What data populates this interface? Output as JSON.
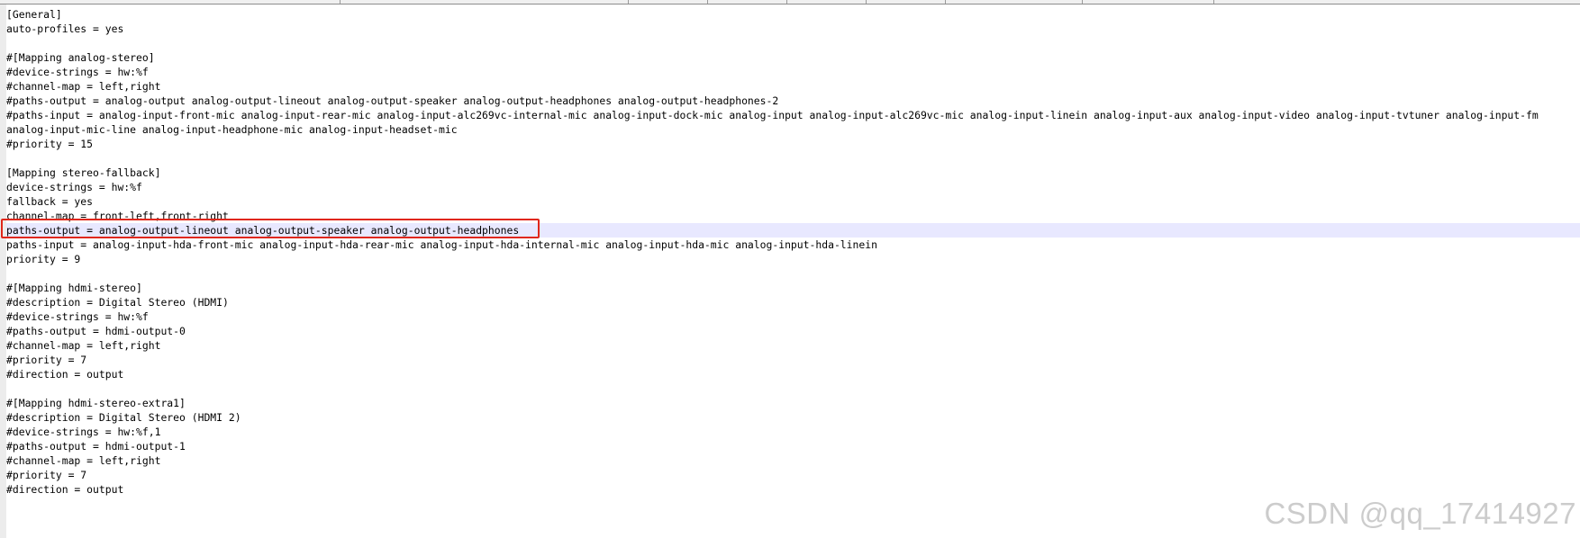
{
  "editor": {
    "lines": [
      "[General]",
      "auto-profiles = yes",
      "",
      "#[Mapping analog-stereo]",
      "#device-strings = hw:%f",
      "#channel-map = left,right",
      "#paths-output = analog-output analog-output-lineout analog-output-speaker analog-output-headphones analog-output-headphones-2",
      "#paths-input = analog-input-front-mic analog-input-rear-mic analog-input-alc269vc-internal-mic analog-input-dock-mic analog-input analog-input-alc269vc-mic analog-input-linein analog-input-aux analog-input-video analog-input-tvtuner analog-input-fm",
      "analog-input-mic-line analog-input-headphone-mic analog-input-headset-mic",
      "#priority = 15",
      "",
      "[Mapping stereo-fallback]",
      "device-strings = hw:%f",
      "fallback = yes",
      "channel-map = front-left,front-right",
      "paths-output = analog-output-lineout analog-output-speaker analog-output-headphones",
      "paths-input = analog-input-hda-front-mic analog-input-hda-rear-mic analog-input-hda-internal-mic analog-input-hda-mic analog-input-hda-linein",
      "priority = 9",
      "",
      "#[Mapping hdmi-stereo]",
      "#description = Digital Stereo (HDMI)",
      "#device-strings = hw:%f",
      "#paths-output = hdmi-output-0",
      "#channel-map = left,right",
      "#priority = 7",
      "#direction = output",
      "",
      "#[Mapping hdmi-stereo-extra1]",
      "#description = Digital Stereo (HDMI 2)",
      "#device-strings = hw:%f,1",
      "#paths-output = hdmi-output-1",
      "#channel-map = left,right",
      "#priority = 7",
      "#direction = output"
    ],
    "current_line_index": 15
  },
  "watermark": "CSDN @qq_17414927",
  "colors": {
    "highlight_border": "#e0271a",
    "current_line_bg": "#e8e8ff"
  }
}
